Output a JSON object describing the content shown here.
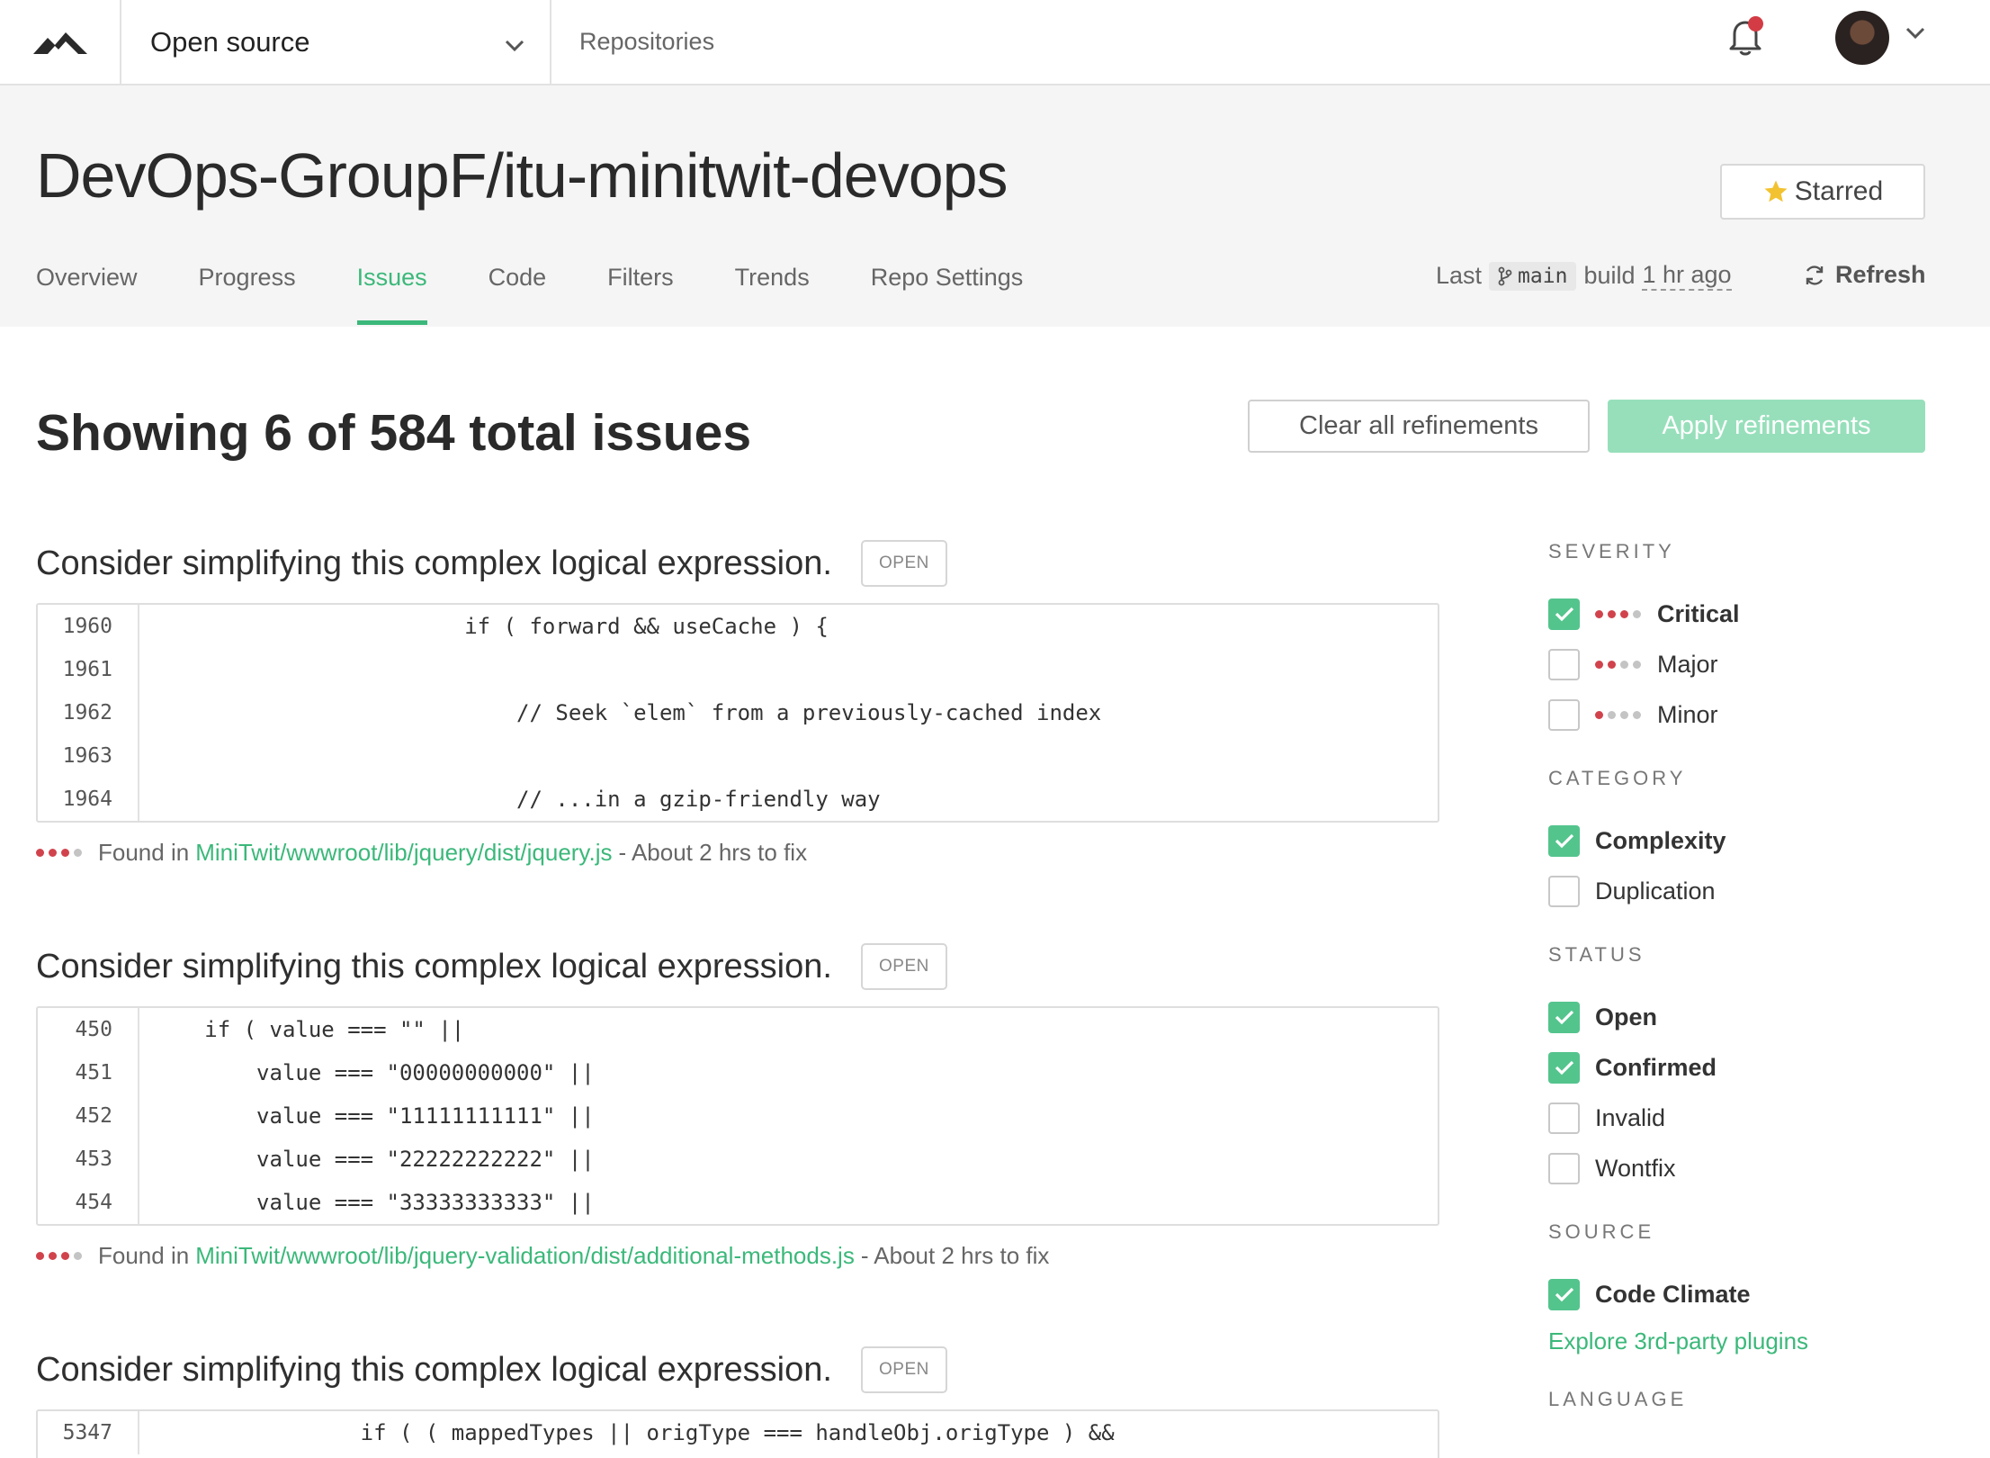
{
  "nav": {
    "org": "Open source",
    "repositories": "Repositories"
  },
  "repo": {
    "title": "DevOps-GroupF/itu-minitwit-devops",
    "star_label": "Starred",
    "tabs": [
      "Overview",
      "Progress",
      "Issues",
      "Code",
      "Filters",
      "Trends",
      "Repo Settings"
    ],
    "active_tab": "Issues",
    "build": {
      "prefix": "Last",
      "branch": "main",
      "middle": "build",
      "ago": "1 hr ago"
    },
    "refresh_label": "Refresh"
  },
  "summary": {
    "text": "Showing 6 of 584 total issues",
    "clear_label": "Clear all refinements",
    "apply_label": "Apply refinements"
  },
  "issues": [
    {
      "title": "Consider simplifying this complex logical expression.",
      "status": "OPEN",
      "lines": [
        {
          "n": "1960",
          "code": "                         if ( forward && useCache ) {"
        },
        {
          "n": "1961",
          "code": ""
        },
        {
          "n": "1962",
          "code": "                             // Seek `elem` from a previously-cached index"
        },
        {
          "n": "1963",
          "code": ""
        },
        {
          "n": "1964",
          "code": "                             // ...in a gzip-friendly way"
        }
      ],
      "found_prefix": "Found in",
      "path": "MiniTwit/wwwroot/lib/jquery/dist/jquery.js",
      "fix": "- About 2 hrs to fix"
    },
    {
      "title": "Consider simplifying this complex logical expression.",
      "status": "OPEN",
      "lines": [
        {
          "n": "450",
          "code": "     if ( value === \"\" ||"
        },
        {
          "n": "451",
          "code": "         value === \"00000000000\" ||"
        },
        {
          "n": "452",
          "code": "         value === \"11111111111\" ||"
        },
        {
          "n": "453",
          "code": "         value === \"22222222222\" ||"
        },
        {
          "n": "454",
          "code": "         value === \"33333333333\" ||"
        }
      ],
      "found_prefix": "Found in",
      "path": "MiniTwit/wwwroot/lib/jquery-validation/dist/additional-methods.js",
      "fix": "- About 2 hrs to fix"
    },
    {
      "title": "Consider simplifying this complex logical expression.",
      "status": "OPEN",
      "lines": [
        {
          "n": "5347",
          "code": "                 if ( ( mappedTypes || origType === handleObj.origType ) &&"
        }
      ]
    }
  ],
  "sidebar": {
    "severity": {
      "heading": "SEVERITY",
      "items": [
        {
          "label": "Critical",
          "checked": true,
          "level": 3
        },
        {
          "label": "Major",
          "checked": false,
          "level": 2
        },
        {
          "label": "Minor",
          "checked": false,
          "level": 1
        }
      ]
    },
    "category": {
      "heading": "CATEGORY",
      "items": [
        {
          "label": "Complexity",
          "checked": true
        },
        {
          "label": "Duplication",
          "checked": false
        }
      ]
    },
    "status": {
      "heading": "STATUS",
      "items": [
        {
          "label": "Open",
          "checked": true
        },
        {
          "label": "Confirmed",
          "checked": true
        },
        {
          "label": "Invalid",
          "checked": false
        },
        {
          "label": "Wontfix",
          "checked": false
        }
      ]
    },
    "source": {
      "heading": "SOURCE",
      "items": [
        {
          "label": "Code Climate",
          "checked": true
        }
      ],
      "explore": "Explore 3rd-party plugins"
    },
    "language": {
      "heading": "LANGUAGE"
    }
  },
  "colors": {
    "accent": "#3bb87a",
    "severity_red": "#d1434c"
  }
}
